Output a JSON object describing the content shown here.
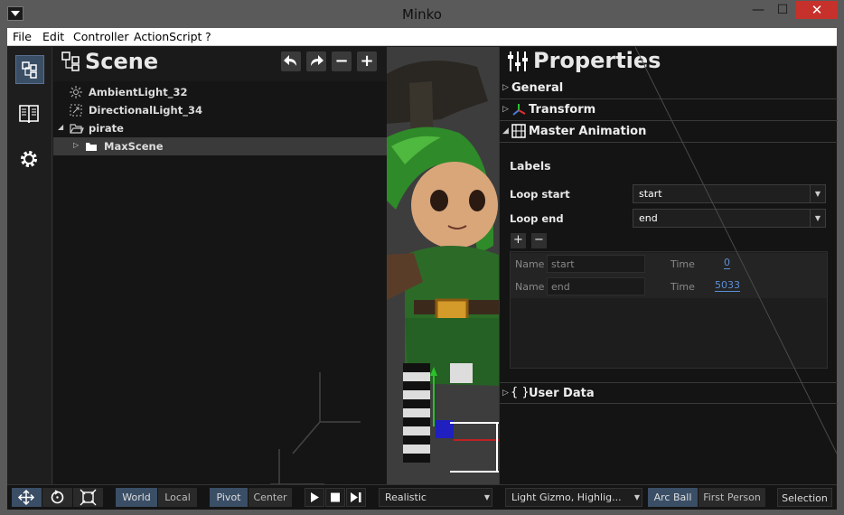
{
  "window": {
    "title": "Minko",
    "close_glyph": "✕",
    "minimize_glyph": "—",
    "maximize_glyph": "☐"
  },
  "menu": [
    "File",
    "Edit",
    "Controller",
    "ActionScript",
    "?"
  ],
  "toolstrip": {
    "icons": [
      "scene-graph-icon",
      "library-icon",
      "settings-gear-icon"
    ]
  },
  "scene": {
    "title": "Scene",
    "buttons": {
      "undo": "undo-icon",
      "redo": "redo-icon",
      "remove": "−",
      "add": "+"
    },
    "tree": [
      {
        "label": "AmbientLight_32",
        "icon": "ambient-light-icon"
      },
      {
        "label": "DirectionalLight_34",
        "icon": "directional-light-icon"
      },
      {
        "label": "pirate",
        "icon": "folder-open-icon",
        "expanded": true
      },
      {
        "label": "MaxScene",
        "icon": "folder-icon",
        "selected": true
      }
    ]
  },
  "properties": {
    "title": "Properties",
    "sections": {
      "general": "General",
      "transform": "Transform",
      "master_animation": "Master Animation",
      "user_data": "User Data"
    },
    "labels_heading": "Labels",
    "loop_start_label": "Loop start",
    "loop_start_value": "start",
    "loop_end_label": "Loop end",
    "loop_end_value": "end",
    "add_btn": "+",
    "remove_btn": "−",
    "label_rows": [
      {
        "name_label": "Name",
        "name": "start",
        "time_label": "Time",
        "time": "0"
      },
      {
        "name_label": "Name",
        "name": "end",
        "time_label": "Time",
        "time": "5033"
      }
    ]
  },
  "bottombar": {
    "space": {
      "world": "World",
      "local": "Local"
    },
    "pivot": {
      "pivot": "Pivot",
      "center": "Center"
    },
    "render_mode": "Realistic",
    "gizmo_options": "Light Gizmo, Highlig...",
    "camera": {
      "arcball": "Arc Ball",
      "first_person": "First Person"
    },
    "selection": "Selection"
  },
  "colors": {
    "accent": "#3a4e66",
    "close": "#c7312b",
    "link": "#5b8fd6"
  }
}
